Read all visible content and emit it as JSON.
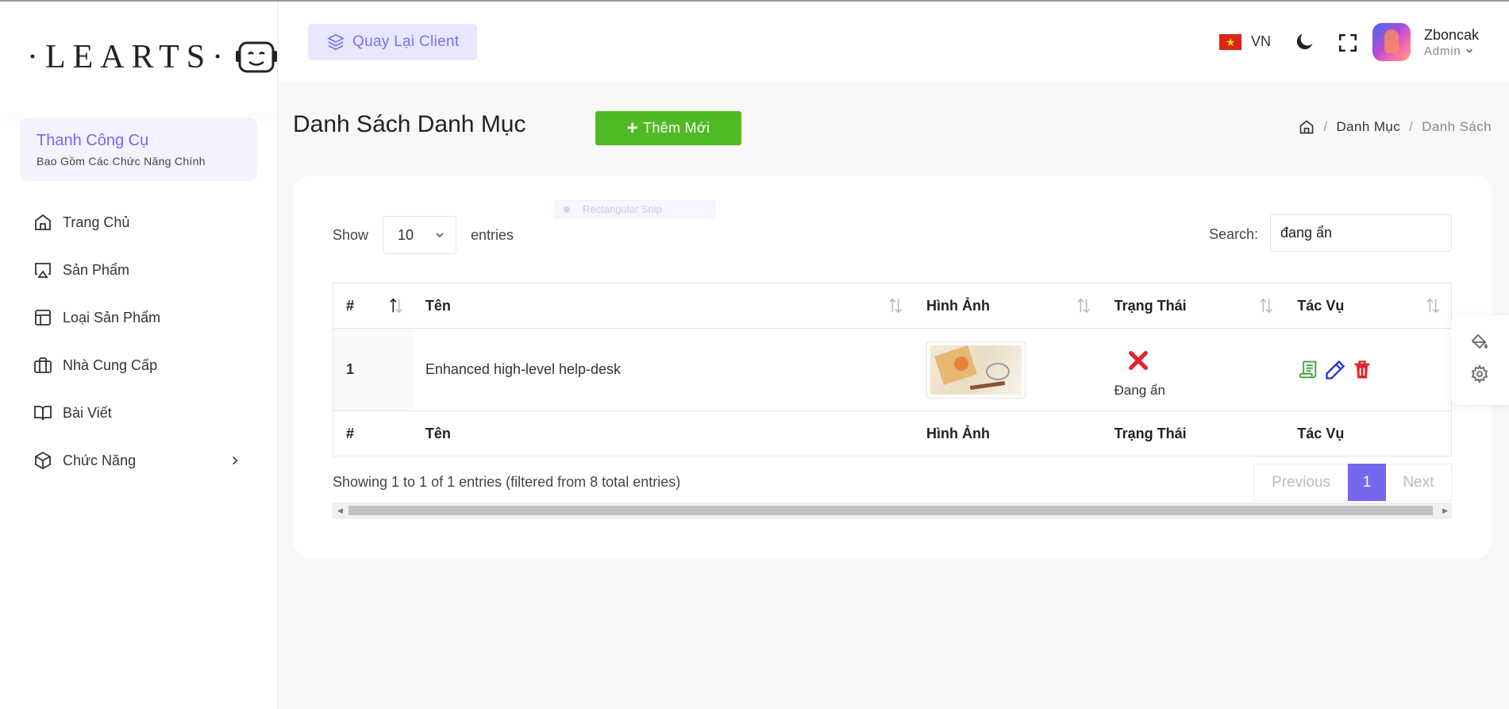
{
  "brand": {
    "logo_text": "·LEARTS·"
  },
  "sidebar": {
    "toolbox_title": "Thanh Công Cụ",
    "toolbox_subtitle": "Bao Gồm Các Chức Năng Chính",
    "items": [
      {
        "label": "Trang Chủ",
        "icon": "home-icon"
      },
      {
        "label": "Sản Phẩm",
        "icon": "airplay-icon"
      },
      {
        "label": "Loại Sản Phẩm",
        "icon": "layout-icon"
      },
      {
        "label": "Nhà Cung Cấp",
        "icon": "briefcase-icon"
      },
      {
        "label": "Bài Viết",
        "icon": "book-icon"
      },
      {
        "label": "Chức Năng",
        "icon": "box-icon"
      }
    ]
  },
  "header": {
    "back_button": "Quay Lại Client",
    "language": "VN",
    "user_name": "Zboncak",
    "user_role": "Admin"
  },
  "page": {
    "title": "Danh Sách Danh Mục",
    "add_button": "Thêm Mới",
    "breadcrumb": [
      "Danh Mục",
      "Danh Sách"
    ]
  },
  "snip_overlay": "Rectangular Snip",
  "table_controls": {
    "show_label": "Show",
    "entries_value": "10",
    "entries_label": "entries",
    "search_label": "Search:",
    "search_value": "đang ẩn"
  },
  "table": {
    "columns": [
      "#",
      "Tên",
      "Hình Ảnh",
      "Trạng Thái",
      "Tác Vụ"
    ],
    "rows": [
      {
        "index": "1",
        "name": "Enhanced high-level help-desk",
        "status": "Đang ẩn"
      }
    ]
  },
  "footer": {
    "info": "Showing 1 to 1 of 1 entries (filtered from 8 total entries)",
    "previous": "Previous",
    "current_page": "1",
    "next": "Next"
  },
  "colors": {
    "accent": "#7467f0",
    "success": "#4fbb24",
    "danger": "#e0242c"
  }
}
